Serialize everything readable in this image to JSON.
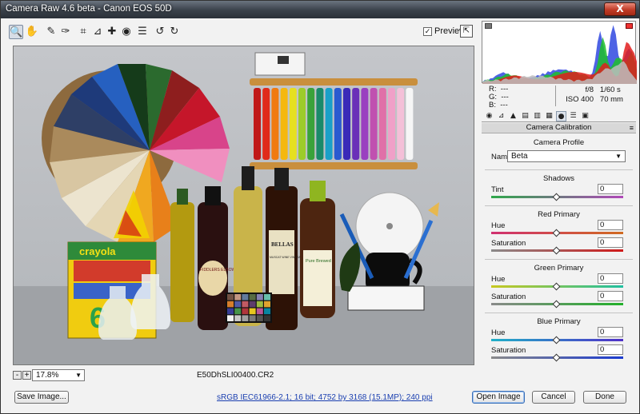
{
  "window": {
    "title": "Camera Raw 4.6 beta  -  Canon EOS 50D",
    "close_label": "X"
  },
  "toolbar": {
    "tools": [
      {
        "name": "zoom-tool",
        "glyph": "🔍"
      },
      {
        "name": "hand-tool",
        "glyph": "✋"
      },
      {
        "name": "white-balance-tool",
        "glyph": "✎"
      },
      {
        "name": "color-sampler-tool",
        "glyph": "✑"
      },
      {
        "name": "crop-tool",
        "glyph": "⌗"
      },
      {
        "name": "straighten-tool",
        "glyph": "⊿"
      },
      {
        "name": "retouch-tool",
        "glyph": "✚"
      },
      {
        "name": "red-eye-tool",
        "glyph": "◉"
      },
      {
        "name": "preferences-tool",
        "glyph": "☰"
      },
      {
        "name": "rotate-ccw-tool",
        "glyph": "↺"
      },
      {
        "name": "rotate-cw-tool",
        "glyph": "↻"
      }
    ],
    "preview_label": "Preview",
    "preview_checked": "✓",
    "fullscreen_glyph": "⇱"
  },
  "image": {
    "zoom_minus": "-",
    "zoom_plus": "+",
    "zoom_level": "17.8%",
    "filename": "E50DhSLI00400.CR2"
  },
  "readout": {
    "r_label": "R:",
    "r_value": "---",
    "g_label": "G:",
    "g_value": "---",
    "b_label": "B:",
    "b_value": "---",
    "aperture": "f/8",
    "shutter": "1/60 s",
    "iso": "ISO 400",
    "focal": "70 mm"
  },
  "panel": {
    "title": "Camera Calibration",
    "menu_glyph": "≡",
    "profile_heading": "Camera Profile",
    "name_label": "Name:",
    "name_value": "Beta",
    "shadows_heading": "Shadows",
    "tint_label": "Tint",
    "tint_value": "0",
    "red_heading": "Red Primary",
    "red_hue_label": "Hue",
    "red_hue_value": "0",
    "red_sat_label": "Saturation",
    "red_sat_value": "0",
    "green_heading": "Green Primary",
    "green_hue_label": "Hue",
    "green_hue_value": "0",
    "green_sat_label": "Saturation",
    "green_sat_value": "0",
    "blue_heading": "Blue Primary",
    "blue_hue_label": "Hue",
    "blue_hue_value": "0",
    "blue_sat_label": "Saturation",
    "blue_sat_value": "0"
  },
  "footer": {
    "save_label": "Save Image...",
    "workflow_text": "sRGB IEC61966-2.1; 16 bit; 4752 by 3168 (15.1MP); 240 ppi",
    "open_label": "Open Image",
    "cancel_label": "Cancel",
    "done_label": "Done"
  },
  "image_text": {
    "bottle2_label": "FIDDLERS ELBOW",
    "bottle4_label": "BELLAS",
    "bottle4_sub": "MUSCAT WINE VINEGAR",
    "bottle5_label": "Pure Brewed",
    "crayon_brand": "crayola"
  }
}
